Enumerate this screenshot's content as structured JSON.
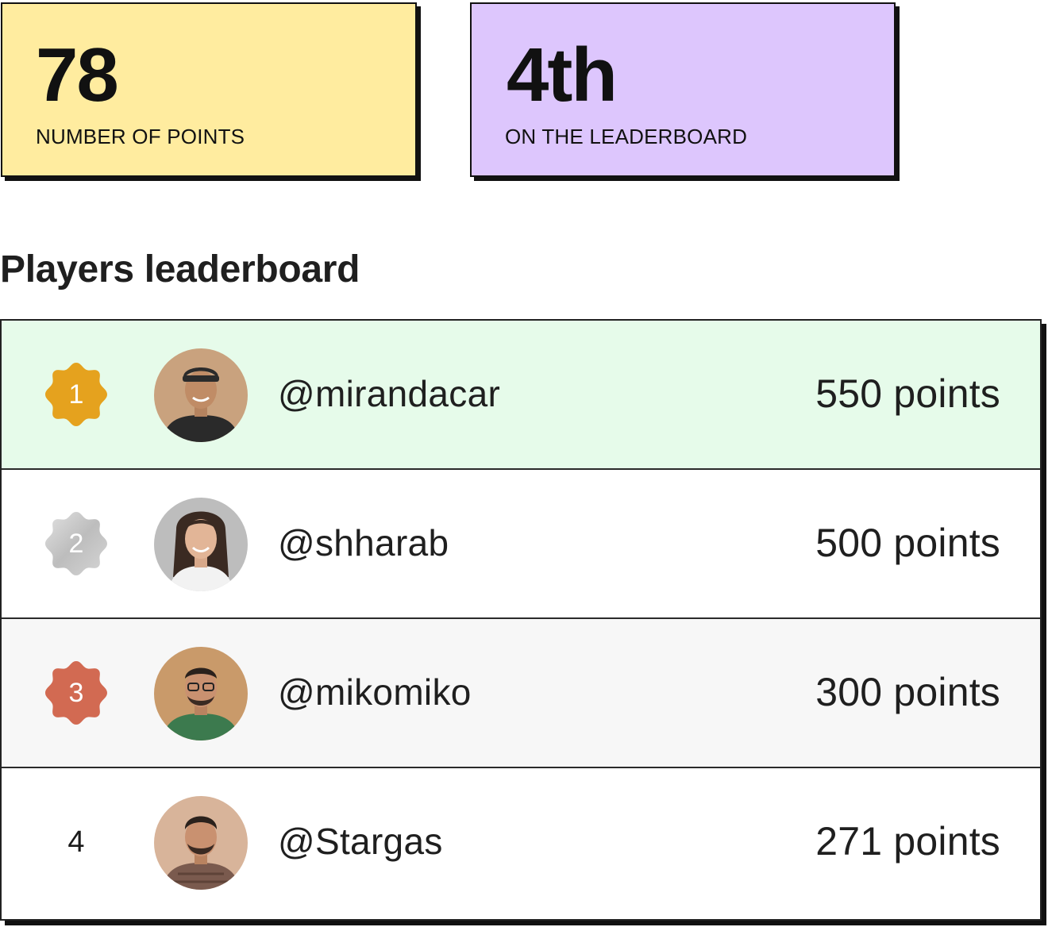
{
  "stats": {
    "points": {
      "value": "78",
      "label": "NUMBER OF POINTS",
      "bg_color": "#FFEC9F"
    },
    "rank": {
      "value": "4th",
      "label": "ON THE LEADERBOARD",
      "bg_color": "#DDC6FD"
    }
  },
  "leaderboard": {
    "title": "Players leaderboard",
    "rows": [
      {
        "rank": "1",
        "badge": "gold-medal-icon",
        "username": "@mirandacar",
        "points": "550 points",
        "highlight_color": "#E6FBEA"
      },
      {
        "rank": "2",
        "badge": "silver-medal-icon",
        "username": "@shharab",
        "points": "500 points"
      },
      {
        "rank": "3",
        "badge": "bronze-medal-icon",
        "username": "@mikomiko",
        "points": "300 points"
      },
      {
        "rank": "4",
        "username": "@Stargas",
        "points": "271 points"
      }
    ]
  },
  "colors": {
    "gold": "#E5A21E",
    "silver": "#C9C9C9",
    "bronze": "#D26A52"
  }
}
